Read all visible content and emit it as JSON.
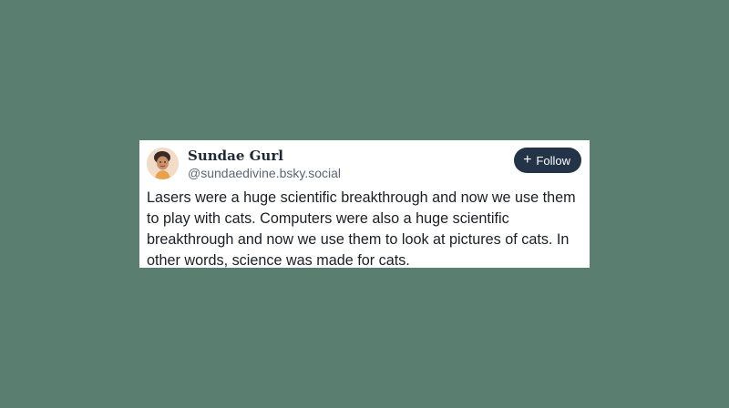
{
  "post": {
    "author": {
      "display_name": "Sundae Gurl",
      "handle": "@sundaedivine.bsky.social",
      "avatar_icon": "avatar-photo"
    },
    "follow_button": {
      "icon": "plus-icon",
      "icon_glyph": "+",
      "label": "Follow"
    },
    "text": "Lasers were a huge scientific breakthrough and now we use them to play with cats. Computers were also a huge scientific breakthrough and now we use them to look at pictures of cats. In other words, science was made for cats."
  },
  "colors": {
    "background": "#5a7f70",
    "card": "#ffffff",
    "button": "#233448",
    "button_text": "#ffffff",
    "handle_text": "#5b6775"
  }
}
